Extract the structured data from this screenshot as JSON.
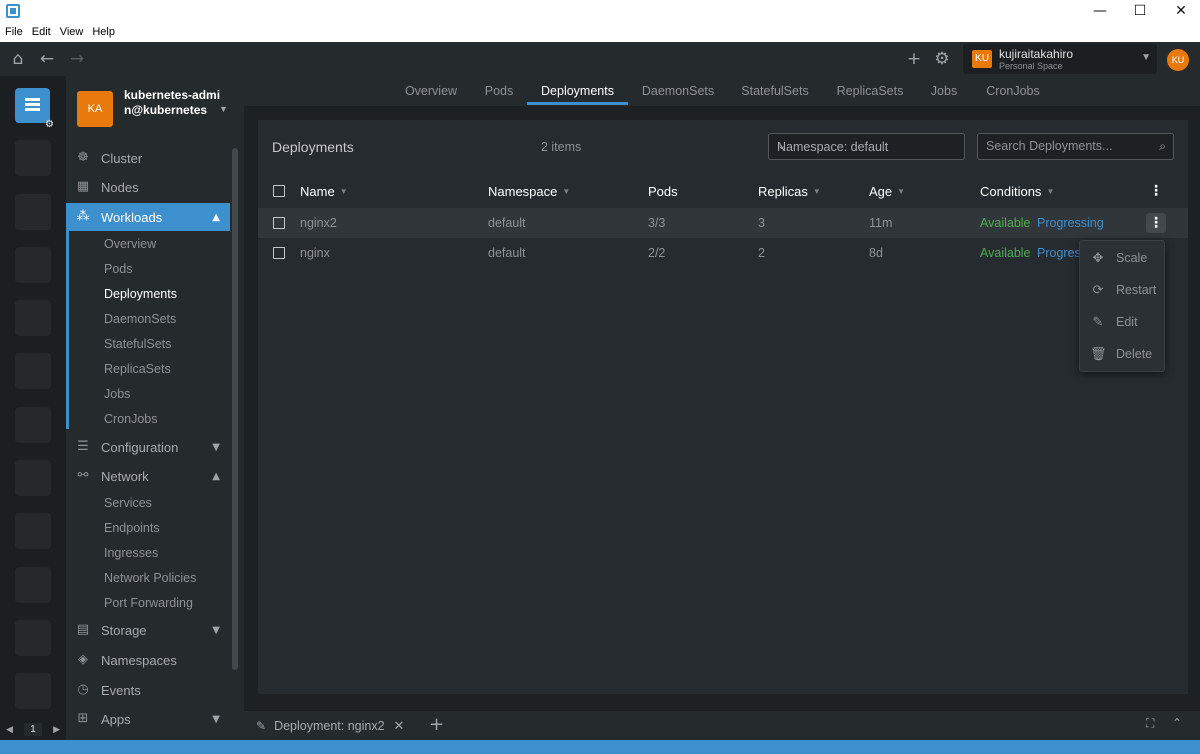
{
  "window": {
    "minimize": "—",
    "maximize": "☐",
    "close": "✕"
  },
  "menu": [
    "File",
    "Edit",
    "View",
    "Help"
  ],
  "workspace": {
    "badge": "KU",
    "name": "kujiraitakahiro",
    "subtitle": "Personal Space"
  },
  "user": {
    "initials": "KU"
  },
  "hotbar": {
    "page": "1"
  },
  "cluster": {
    "badge": "KA",
    "name": "kubernetes-admin@kubernetes"
  },
  "sidebar": {
    "cluster": "Cluster",
    "nodes": "Nodes",
    "workloads": "Workloads",
    "workloads_items": [
      "Overview",
      "Pods",
      "Deployments",
      "DaemonSets",
      "StatefulSets",
      "ReplicaSets",
      "Jobs",
      "CronJobs"
    ],
    "configuration": "Configuration",
    "network": "Network",
    "network_items": [
      "Services",
      "Endpoints",
      "Ingresses",
      "Network Policies",
      "Port Forwarding"
    ],
    "storage": "Storage",
    "namespaces": "Namespaces",
    "events": "Events",
    "apps": "Apps"
  },
  "tabs": [
    "Overview",
    "Pods",
    "Deployments",
    "DaemonSets",
    "StatefulSets",
    "ReplicaSets",
    "Jobs",
    "CronJobs"
  ],
  "panel": {
    "title": "Deployments",
    "count": "2 items",
    "namespace_filter": "Namespace: default",
    "search_placeholder": "Search Deployments..."
  },
  "table": {
    "headers": [
      "Name",
      "Namespace",
      "Pods",
      "Replicas",
      "Age",
      "Conditions"
    ],
    "rows": [
      {
        "name": "nginx2",
        "namespace": "default",
        "pods": "3/3",
        "replicas": "3",
        "age": "11m",
        "cond1": "Available",
        "cond2": "Progressing"
      },
      {
        "name": "nginx",
        "namespace": "default",
        "pods": "2/2",
        "replicas": "2",
        "age": "8d",
        "cond1": "Available",
        "cond2": "Progres"
      }
    ]
  },
  "context_menu": [
    "Scale",
    "Restart",
    "Edit",
    "Delete"
  ],
  "dock": {
    "tab_label": "Deployment: nginx2"
  },
  "colors": {
    "accent": "#3d90ce",
    "badge": "#e87a0d",
    "available": "#4caf50",
    "progressing": "#3d90ce"
  }
}
